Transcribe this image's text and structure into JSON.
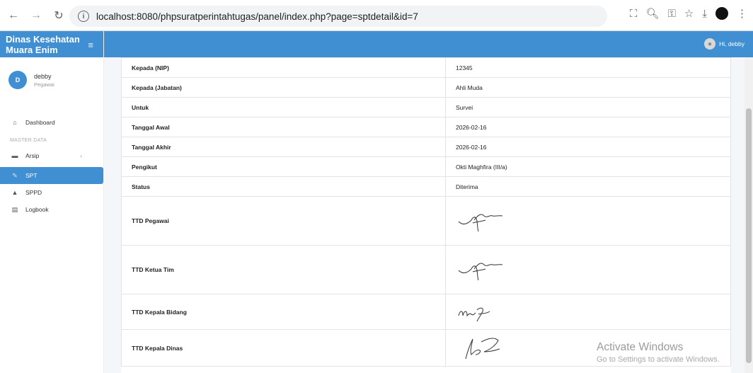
{
  "browser": {
    "url": "localhost:8080/phpsuratperintahtugas/panel/index.php?page=sptdetail&id=7"
  },
  "sidebar": {
    "brand": "Dinas Kesehatan Muara Enim",
    "user": {
      "initial": "D",
      "name": "debby",
      "role": "Pegawai"
    },
    "items": [
      {
        "label": "Dashboard",
        "icon": "home-icon"
      },
      {
        "label": "Arsip",
        "icon": "archive-icon"
      },
      {
        "label": "SPT",
        "icon": "document-icon"
      },
      {
        "label": "SPPD",
        "icon": "plane-icon"
      },
      {
        "label": "Logbook",
        "icon": "book-icon"
      }
    ],
    "section_label": "MASTER DATA"
  },
  "header": {
    "greeting": "Hi, debby"
  },
  "detail": {
    "rows": [
      {
        "label": "Kepada (NIP)",
        "value": "12345"
      },
      {
        "label": "Kepada (Jabatan)",
        "value": "Ahli Muda"
      },
      {
        "label": "Untuk",
        "value": "Survei"
      },
      {
        "label": "Tanggal Awal",
        "value": "2026-02-16"
      },
      {
        "label": "Tanggal Akhir",
        "value": "2026-02-16"
      },
      {
        "label": "Pengikut",
        "value": "Okti Maghfira (III/a)"
      },
      {
        "label": "Status",
        "value": "Diterima"
      }
    ],
    "signatures": [
      {
        "label": "TTD Pegawai"
      },
      {
        "label": "TTD Ketua Tim"
      },
      {
        "label": "TTD Kepala Bidang"
      },
      {
        "label": "TTD Kepala Dinas"
      }
    ]
  },
  "watermark": {
    "title": "Activate Windows",
    "subtitle": "Go to Settings to activate Windows."
  },
  "colors": {
    "primary": "#3f8fd2"
  }
}
